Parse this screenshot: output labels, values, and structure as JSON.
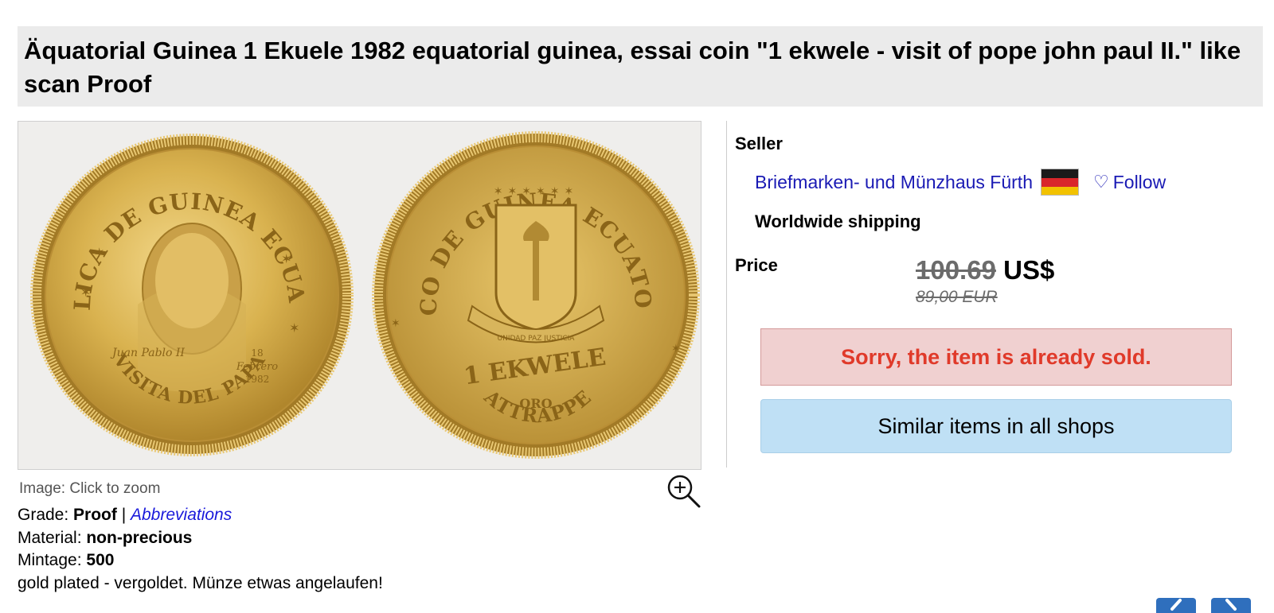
{
  "title": "Äquatorial Guinea 1 Ekuele 1982 equatorial guinea, essai coin \"1 ekwele - visit of pope john paul II.\" like scan Proof",
  "image": {
    "caption": "Image: Click to zoom",
    "obverse_text_top": "REPUBLICA DE GUINEA ECUATORIAL",
    "obverse_text_bottom": "VISITA DEL PAPA",
    "obverse_signature": "Juan Pablo II",
    "obverse_date_day": "18",
    "obverse_date_month": "Febrero",
    "obverse_date_year": "1982",
    "reverse_text_top": "BANCO DE GUINEA ECUATORIAL",
    "reverse_value": "1 EKWELE",
    "reverse_metal": "ORO",
    "reverse_bottom": "ATTRAPPE",
    "reverse_ribbon": "UNIDAD PAZ JUSTICIA"
  },
  "details": {
    "grade_label": "Grade: ",
    "grade_value": "Proof",
    "separator": " | ",
    "abbreviations_link": "Abbreviations",
    "material_label": "Material: ",
    "material_value": "non-precious",
    "mintage_label": "Mintage: ",
    "mintage_value": "500",
    "note": "gold plated - vergoldet. Münze etwas angelaufen!"
  },
  "seller": {
    "label": "Seller",
    "name": "Briefmarken- und Münzhaus Fürth",
    "flag": "germany-flag",
    "follow_icon": "heart-outline-icon",
    "follow_label": "Follow",
    "shipping": "Worldwide shipping"
  },
  "price": {
    "label": "Price",
    "amount": "100.69",
    "currency": " US$",
    "eur": "89,00 EUR"
  },
  "status": {
    "sold_message": "Sorry, the item is already sold.",
    "similar_button": "Similar items in all shops"
  },
  "colors": {
    "title_bg": "#ebebeb",
    "sold_bg": "#f0d0d0",
    "sold_text": "#e03a2a",
    "similar_bg": "#bfe0f5",
    "link": "#1a1ab4",
    "nav_button": "#2f6fbd"
  }
}
